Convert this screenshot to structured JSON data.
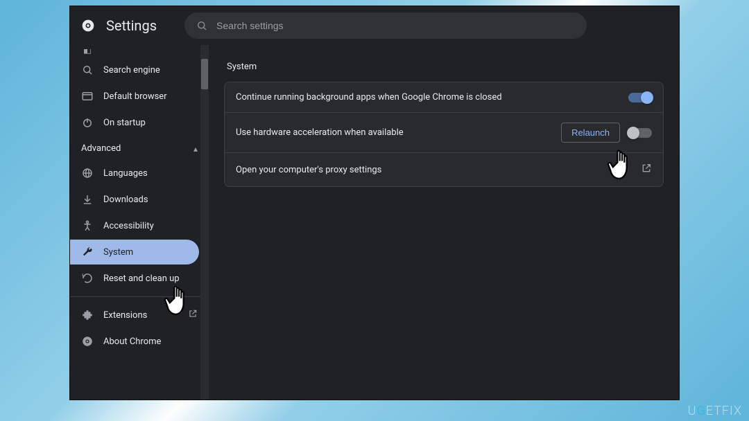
{
  "header": {
    "title": "Settings",
    "search_placeholder": "Search settings"
  },
  "sidebar": {
    "section_advanced": "Advanced",
    "items": {
      "search_engine": "Search engine",
      "default_browser": "Default browser",
      "on_startup": "On startup",
      "languages": "Languages",
      "downloads": "Downloads",
      "accessibility": "Accessibility",
      "system": "System",
      "reset": "Reset and clean up",
      "extensions": "Extensions",
      "about": "About Chrome"
    }
  },
  "main": {
    "section_title": "System",
    "rows": {
      "bg_apps": "Continue running background apps when Google Chrome is closed",
      "hw_accel": "Use hardware acceleration when available",
      "relaunch": "Relaunch",
      "proxy": "Open your computer's proxy settings"
    },
    "toggles": {
      "bg_apps": true,
      "hw_accel": false
    }
  },
  "watermark": "UGETFIX"
}
